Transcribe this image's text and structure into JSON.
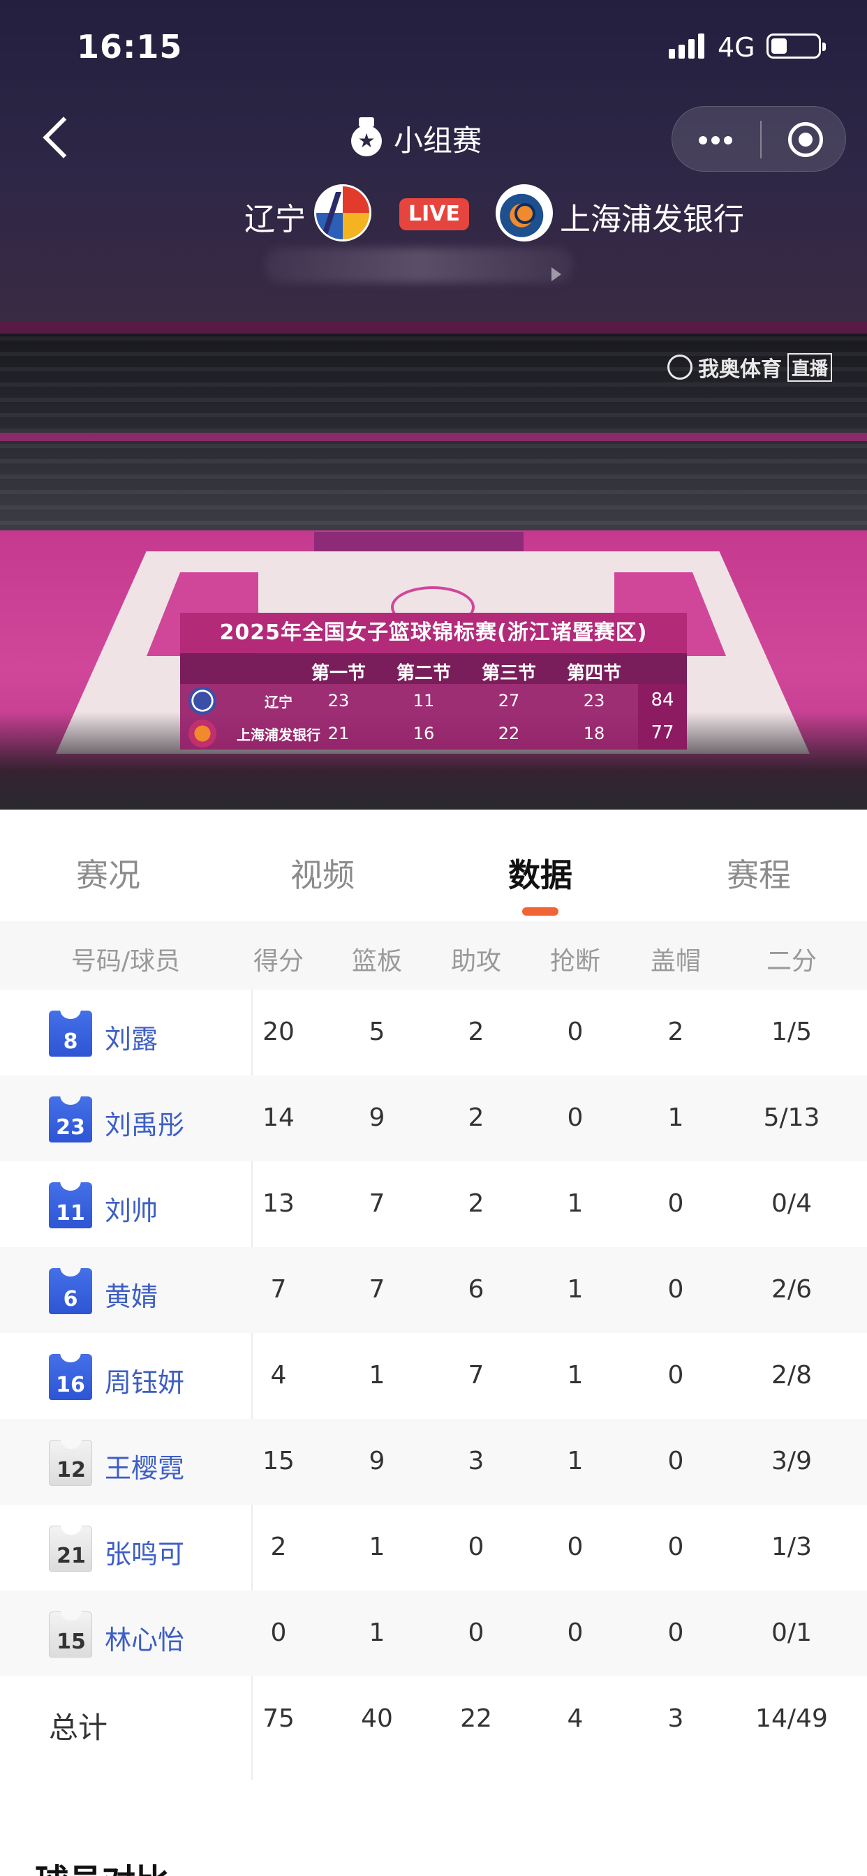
{
  "status_bar": {
    "time": "16:15",
    "network": "4G"
  },
  "header": {
    "round": "小组赛",
    "home_team": "辽宁",
    "live_badge": "LIVE",
    "away_team": "上海浦发银行"
  },
  "video": {
    "broadcaster": "我奥体育",
    "broadcaster_tag": "直播",
    "scoreboard": {
      "title": "2025年全国女子篮球锦标赛(浙江诸暨赛区)",
      "quarters": [
        "第一节",
        "第二节",
        "第三节",
        "第四节"
      ],
      "teams": [
        {
          "name": "辽宁",
          "scores": [
            "23",
            "11",
            "27",
            "23"
          ],
          "total": "84"
        },
        {
          "name": "上海浦发银行",
          "scores": [
            "21",
            "16",
            "22",
            "18"
          ],
          "total": "77"
        }
      ]
    }
  },
  "tabs": [
    {
      "label": "赛况",
      "active": false
    },
    {
      "label": "视频",
      "active": false
    },
    {
      "label": "数据",
      "active": true
    },
    {
      "label": "赛程",
      "active": false
    }
  ],
  "stats_table": {
    "columns": [
      "号码/球员",
      "得分",
      "篮板",
      "助攻",
      "抢断",
      "盖帽",
      "二分"
    ],
    "rows": [
      {
        "number": "8",
        "jersey": "blue",
        "name": "刘露",
        "pts": "20",
        "reb": "5",
        "ast": "2",
        "stl": "0",
        "blk": "2",
        "two": "1/5"
      },
      {
        "number": "23",
        "jersey": "blue",
        "name": "刘禹彤",
        "pts": "14",
        "reb": "9",
        "ast": "2",
        "stl": "0",
        "blk": "1",
        "two": "5/13"
      },
      {
        "number": "11",
        "jersey": "blue",
        "name": "刘帅",
        "pts": "13",
        "reb": "7",
        "ast": "2",
        "stl": "1",
        "blk": "0",
        "two": "0/4"
      },
      {
        "number": "6",
        "jersey": "blue",
        "name": "黄婧",
        "pts": "7",
        "reb": "7",
        "ast": "6",
        "stl": "1",
        "blk": "0",
        "two": "2/6"
      },
      {
        "number": "16",
        "jersey": "blue",
        "name": "周钰妍",
        "pts": "4",
        "reb": "1",
        "ast": "7",
        "stl": "1",
        "blk": "0",
        "two": "2/8"
      },
      {
        "number": "12",
        "jersey": "white",
        "name": "王樱霓",
        "pts": "15",
        "reb": "9",
        "ast": "3",
        "stl": "1",
        "blk": "0",
        "two": "3/9"
      },
      {
        "number": "21",
        "jersey": "white",
        "name": "张鸣可",
        "pts": "2",
        "reb": "1",
        "ast": "0",
        "stl": "0",
        "blk": "0",
        "two": "1/3"
      },
      {
        "number": "15",
        "jersey": "white",
        "name": "林心怡",
        "pts": "0",
        "reb": "1",
        "ast": "0",
        "stl": "0",
        "blk": "0",
        "two": "0/1"
      }
    ],
    "total": {
      "label": "总计",
      "pts": "75",
      "reb": "40",
      "ast": "22",
      "stl": "4",
      "blk": "3",
      "two": "14/49"
    }
  },
  "compare_section": {
    "title": "球员对比"
  },
  "colors": {
    "header_bg": "#2e2746",
    "live_red": "#e5453e",
    "tab_indicator": "#f06437",
    "player_link": "#3d5ec4",
    "scoreboard_magenta": "#b32a79"
  }
}
